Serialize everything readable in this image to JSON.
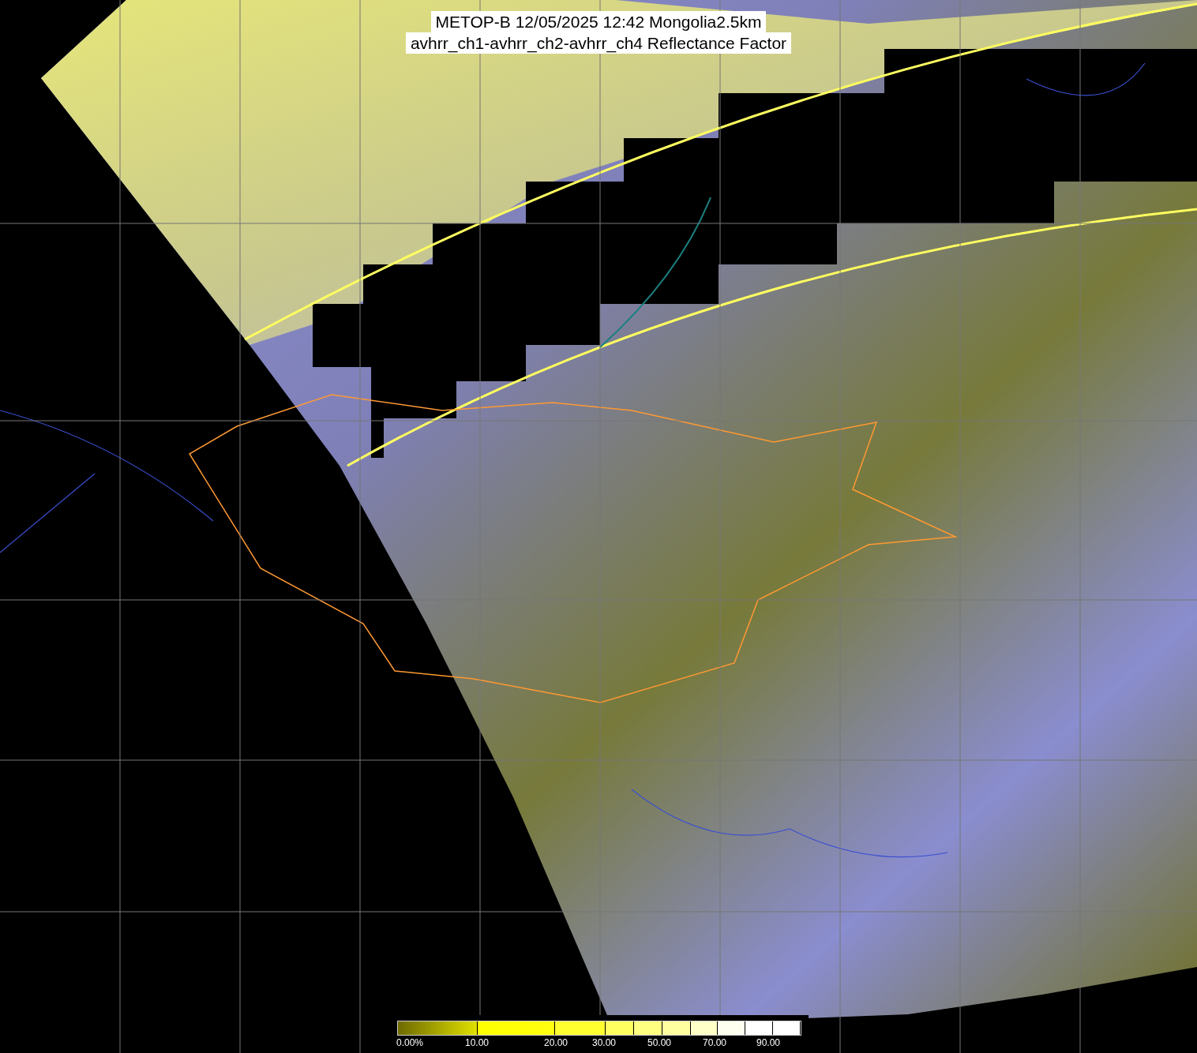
{
  "title": {
    "lines": [
      "METOP-B 12/05/2025 12:42 Mongolia2.5km",
      "avhrr_ch1-avhrr_ch2-avhrr_ch4 Reflectance Factor"
    ]
  },
  "color_scale": {
    "labels": [
      "0.00%",
      "10.00",
      "20.00",
      "30.00",
      "50.00",
      "70.00",
      "90.00"
    ]
  }
}
